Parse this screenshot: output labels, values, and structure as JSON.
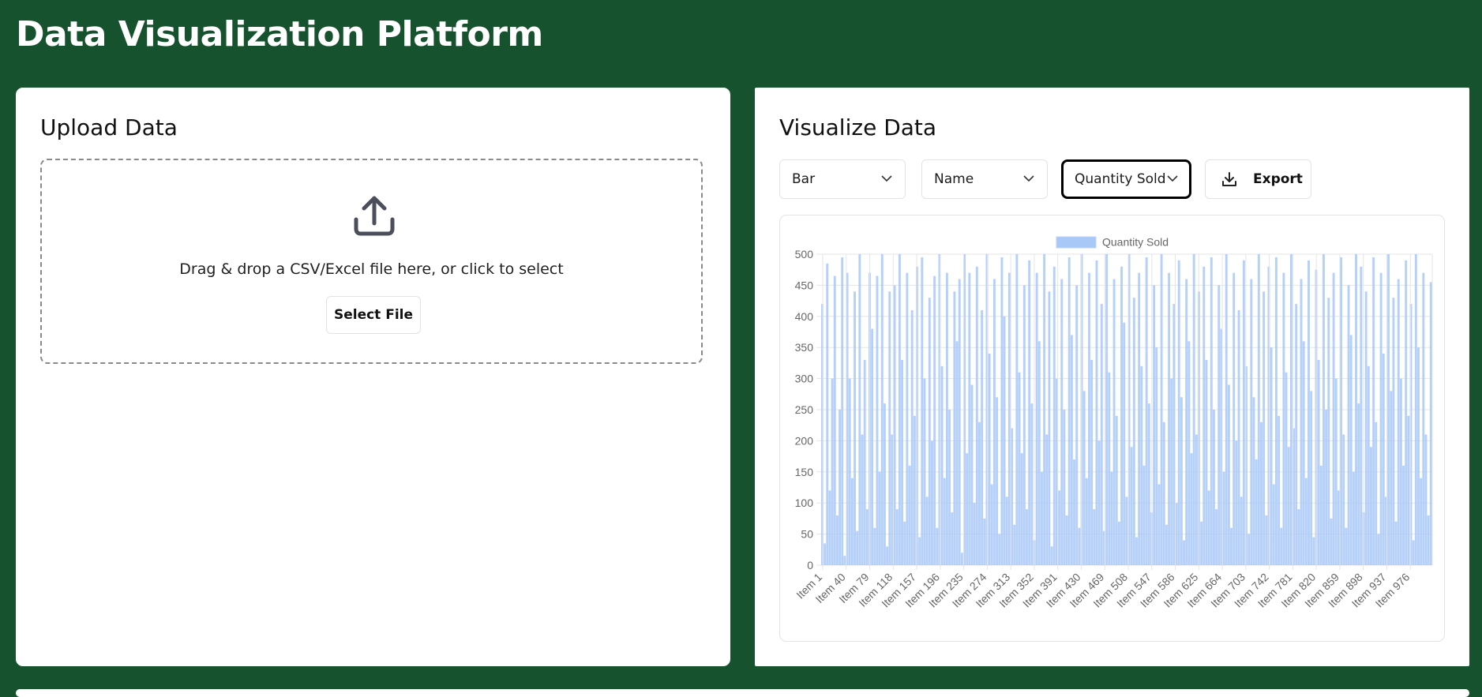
{
  "app": {
    "title": "Data Visualization Platform"
  },
  "upload": {
    "title": "Upload Data",
    "drop_text": "Drag & drop a CSV/Excel file here, or click to select",
    "select_label": "Select File",
    "icon": "upload-icon"
  },
  "visualize": {
    "title": "Visualize Data",
    "chart_type": "Bar",
    "x_field": "Name",
    "y_field": "Quantity Sold",
    "export_label": "Export",
    "export_icon": "download-icon"
  },
  "colors": {
    "background": "#17522f",
    "bar_fill": "#a8c8f8",
    "bar_border": "#bcd4f7"
  },
  "chart_data": {
    "type": "bar",
    "legend": {
      "label": "Quantity Sold",
      "position": "top"
    },
    "ylim": [
      0,
      500
    ],
    "yticks": [
      0,
      50,
      100,
      150,
      200,
      250,
      300,
      350,
      400,
      450,
      500
    ],
    "grid": true,
    "x_tick_labels": [
      "Item 1",
      "Item 40",
      "Item 79",
      "Item 118",
      "Item 157",
      "Item 196",
      "Item 235",
      "Item 274",
      "Item 313",
      "Item 352",
      "Item 391",
      "Item 430",
      "Item 469",
      "Item 508",
      "Item 547",
      "Item 586",
      "Item 625",
      "Item 664",
      "Item 703",
      "Item 742",
      "Item 781",
      "Item 820",
      "Item 859",
      "Item 898",
      "Item 937",
      "Item 976"
    ],
    "series": [
      {
        "name": "Quantity Sold",
        "values": [
          420,
          35,
          485,
          120,
          300,
          465,
          80,
          250,
          495,
          15,
          470,
          300,
          140,
          440,
          55,
          500,
          210,
          330,
          90,
          470,
          380,
          60,
          465,
          150,
          500,
          260,
          30,
          440,
          210,
          450,
          90,
          500,
          330,
          70,
          470,
          160,
          410,
          240,
          480,
          45,
          495,
          300,
          110,
          430,
          200,
          465,
          60,
          500,
          320,
          140,
          470,
          250,
          85,
          440,
          360,
          460,
          20,
          500,
          180,
          470,
          290,
          100,
          480,
          230,
          410,
          75,
          500,
          340,
          130,
          460,
          270,
          50,
          495,
          400,
          110,
          470,
          220,
          65,
          500,
          310,
          180,
          450,
          90,
          490,
          260,
          40,
          470,
          360,
          150,
          500,
          210,
          440,
          30,
          480,
          300,
          120,
          460,
          250,
          80,
          495,
          370,
          170,
          450,
          60,
          500,
          280,
          140,
          470,
          330,
          90,
          490,
          200,
          420,
          55,
          500,
          310,
          150,
          460,
          240,
          70,
          480,
          390,
          110,
          500,
          190,
          430,
          45,
          470,
          320,
          160,
          495,
          260,
          85,
          450,
          350,
          130,
          500,
          230,
          65,
          470,
          300,
          420,
          100,
          490,
          270,
          40,
          460,
          360,
          180,
          500,
          210,
          440,
          70,
          480,
          330,
          120,
          495,
          250,
          90,
          450,
          380,
          150,
          500,
          290,
          60,
          470,
          200,
          410,
          110,
          490,
          320,
          50,
          460,
          270,
          170,
          500,
          230,
          440,
          80,
          480,
          350,
          130,
          495,
          240,
          60,
          470,
          310,
          190,
          500,
          220,
          420,
          90,
          460,
          360,
          140,
          490,
          280,
          45,
          475,
          330,
          160,
          500,
          250,
          430,
          75,
          470,
          300,
          120,
          495,
          210,
          60,
          450,
          370,
          150,
          500,
          260,
          480,
          85,
          440,
          320,
          190,
          495,
          230,
          50,
          470,
          340,
          110,
          500,
          280,
          430,
          70,
          460,
          300,
          160,
          490,
          240,
          420,
          40,
          500,
          350,
          140,
          470,
          210,
          80,
          455
        ]
      }
    ]
  }
}
